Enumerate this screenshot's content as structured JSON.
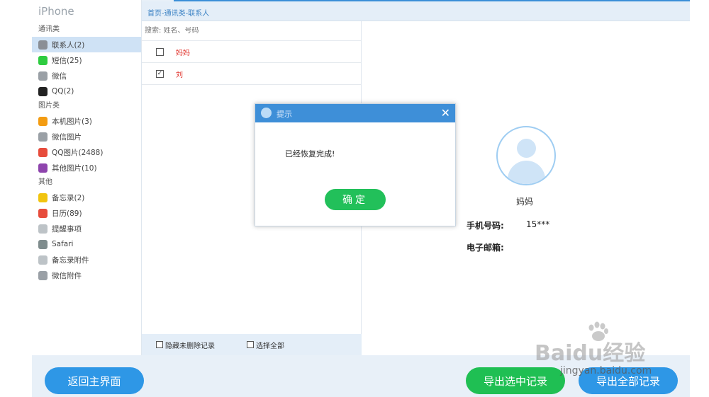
{
  "app": {
    "title": "iPhone"
  },
  "breadcrumb": "首页-通讯类-联系人",
  "sidebar": {
    "groups": [
      {
        "title": "通讯类",
        "items": [
          {
            "label": "联系人(2)",
            "icon": "contacts-icon",
            "color": "#8a8f96",
            "active": true
          },
          {
            "label": "短信(25)",
            "icon": "sms-icon",
            "color": "#2ecc40"
          },
          {
            "label": "微信",
            "icon": "wechat-icon",
            "color": "#9aa0a6"
          },
          {
            "label": "QQ(2)",
            "icon": "qq-penguin-icon",
            "color": "#222222"
          }
        ]
      },
      {
        "title": "图片类",
        "items": [
          {
            "label": "本机图片(3)",
            "icon": "photos-icon",
            "color": "#f39c12"
          },
          {
            "label": "微信图片",
            "icon": "wechat-photos-icon",
            "color": "#9aa0a6"
          },
          {
            "label": "QQ图片(2488)",
            "icon": "qq-photos-icon",
            "color": "#e74c3c"
          },
          {
            "label": "其他图片(10)",
            "icon": "other-photos-icon",
            "color": "#8e44ad"
          }
        ]
      },
      {
        "title": "其他",
        "items": [
          {
            "label": "备忘录(2)",
            "icon": "notes-icon",
            "color": "#f1c40f"
          },
          {
            "label": "日历(89)",
            "icon": "calendar-icon",
            "color": "#e74c3c"
          },
          {
            "label": "提醒事项",
            "icon": "reminders-icon",
            "color": "#bdc3c7"
          },
          {
            "label": "Safari",
            "icon": "safari-icon",
            "color": "#7f8c8d"
          },
          {
            "label": "备忘录附件",
            "icon": "notes-attachment-icon",
            "color": "#bdc3c7"
          },
          {
            "label": "微信附件",
            "icon": "wechat-attachment-icon",
            "color": "#9aa0a6"
          }
        ]
      }
    ]
  },
  "list": {
    "search_label": "搜索:",
    "search_placeholder": "姓名、号码",
    "rows": [
      {
        "name": "妈妈",
        "checked": false
      },
      {
        "name": "刘",
        "checked": true
      }
    ],
    "footer": {
      "hide_undeleted": "隐藏未删除记录",
      "select_all": "选择全部"
    }
  },
  "detail": {
    "name": "妈妈",
    "phone_label": "手机号码:",
    "phone_value": "15***",
    "email_label": "电子邮箱:",
    "email_value": ""
  },
  "dialog": {
    "title": "提示",
    "message": "已经恢复完成!",
    "ok_label": "确定",
    "close_glyph": "✕"
  },
  "buttons": {
    "back": "返回主界面",
    "export_selected": "导出选中记录",
    "export_all": "导出全部记录"
  },
  "watermark": {
    "text": "Baidu经验",
    "url": "jingyan.baidu.com"
  }
}
